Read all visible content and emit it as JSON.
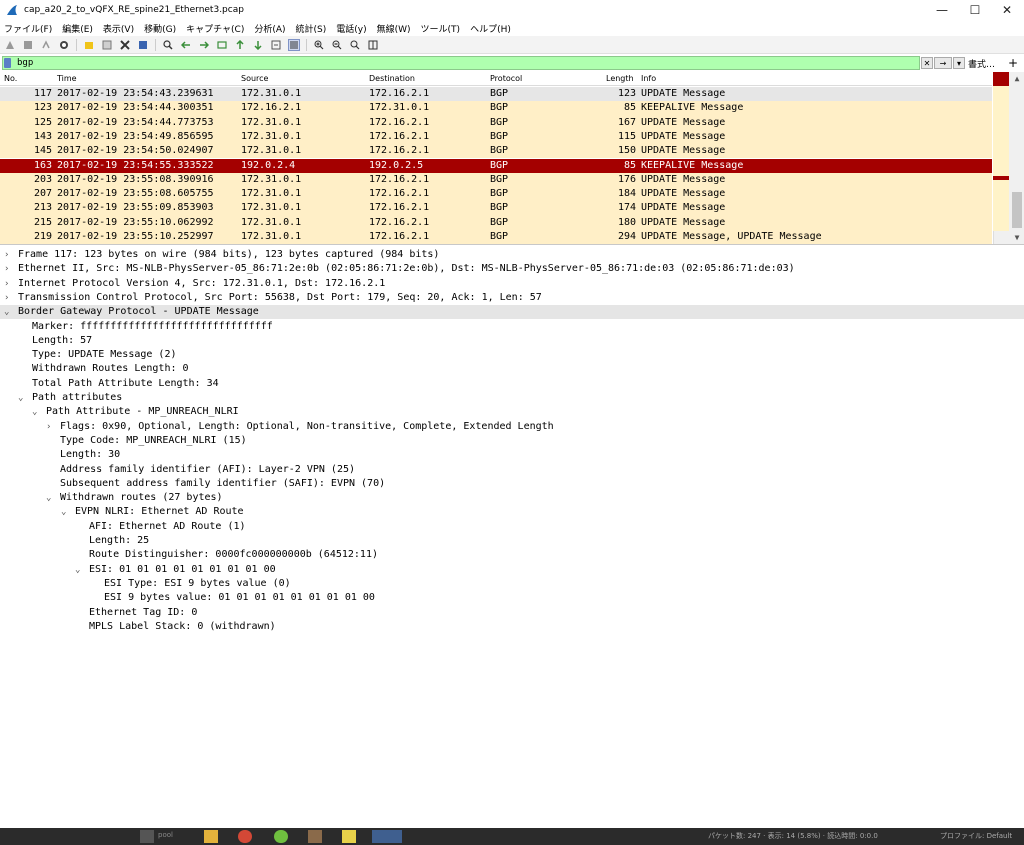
{
  "window": {
    "title": "cap_a20_2_to_vQFX_RE_spine21_Ethernet3.pcap",
    "minimize": "—",
    "maximize": "☐",
    "close": "✕"
  },
  "menu": [
    "ファイル(F)",
    "編集(E)",
    "表示(V)",
    "移動(G)",
    "キャプチャ(C)",
    "分析(A)",
    "統計(S)",
    "電話(y)",
    "無線(W)",
    "ツール(T)",
    "ヘルプ(H)"
  ],
  "filter": {
    "value": "bgp",
    "expression_label": "書式…",
    "plus": "+"
  },
  "packet_list": {
    "columns": [
      "No.",
      "Time",
      "Source",
      "Destination",
      "Protocol",
      "Length",
      "Info"
    ],
    "rows": [
      {
        "no": "117",
        "time": "2017-02-19 23:54:43.239631",
        "src": "172.31.0.1",
        "dst": "172.16.2.1",
        "proto": "BGP",
        "len": "123",
        "info": "UPDATE Message"
      },
      {
        "no": "123",
        "time": "2017-02-19 23:54:44.300351",
        "src": "172.16.2.1",
        "dst": "172.31.0.1",
        "proto": "BGP",
        "len": "85",
        "info": "KEEPALIVE Message"
      },
      {
        "no": "125",
        "time": "2017-02-19 23:54:44.773753",
        "src": "172.31.0.1",
        "dst": "172.16.2.1",
        "proto": "BGP",
        "len": "167",
        "info": "UPDATE Message"
      },
      {
        "no": "143",
        "time": "2017-02-19 23:54:49.856595",
        "src": "172.31.0.1",
        "dst": "172.16.2.1",
        "proto": "BGP",
        "len": "115",
        "info": "UPDATE Message"
      },
      {
        "no": "145",
        "time": "2017-02-19 23:54:50.024907",
        "src": "172.31.0.1",
        "dst": "172.16.2.1",
        "proto": "BGP",
        "len": "150",
        "info": "UPDATE Message"
      },
      {
        "no": "163",
        "time": "2017-02-19 23:54:55.333522",
        "src": "192.0.2.4",
        "dst": "192.0.2.5",
        "proto": "BGP",
        "len": "85",
        "info": "KEEPALIVE Message"
      },
      {
        "no": "203",
        "time": "2017-02-19 23:55:08.390916",
        "src": "172.31.0.1",
        "dst": "172.16.2.1",
        "proto": "BGP",
        "len": "176",
        "info": "UPDATE Message"
      },
      {
        "no": "207",
        "time": "2017-02-19 23:55:08.605755",
        "src": "172.31.0.1",
        "dst": "172.16.2.1",
        "proto": "BGP",
        "len": "184",
        "info": "UPDATE Message"
      },
      {
        "no": "213",
        "time": "2017-02-19 23:55:09.853903",
        "src": "172.31.0.1",
        "dst": "172.16.2.1",
        "proto": "BGP",
        "len": "174",
        "info": "UPDATE Message"
      },
      {
        "no": "215",
        "time": "2017-02-19 23:55:10.062992",
        "src": "172.31.0.1",
        "dst": "172.16.2.1",
        "proto": "BGP",
        "len": "180",
        "info": "UPDATE Message"
      },
      {
        "no": "219",
        "time": "2017-02-19 23:55:10.252997",
        "src": "172.31.0.1",
        "dst": "172.16.2.1",
        "proto": "BGP",
        "len": "294",
        "info": "UPDATE Message, UPDATE Message"
      }
    ]
  },
  "details": [
    {
      "text": "Frame 117: 123 bytes on wire (984 bits), 123 bytes captured (984 bits)",
      "level": 0,
      "arrow": "›"
    },
    {
      "text": "Ethernet II, Src: MS-NLB-PhysServer-05_86:71:2e:0b (02:05:86:71:2e:0b), Dst: MS-NLB-PhysServer-05_86:71:de:03 (02:05:86:71:de:03)",
      "level": 0,
      "arrow": "›"
    },
    {
      "text": "Internet Protocol Version 4, Src: 172.31.0.1, Dst: 172.16.2.1",
      "level": 0,
      "arrow": "›"
    },
    {
      "text": "Transmission Control Protocol, Src Port: 55638, Dst Port: 179, Seq: 20, Ack: 1, Len: 57",
      "level": 0,
      "arrow": "›"
    },
    {
      "text": "Border Gateway Protocol - UPDATE Message",
      "level": 0,
      "arrow": "⌄",
      "selected": true
    },
    {
      "text": "Marker: ffffffffffffffffffffffffffffffff",
      "level": 1,
      "arrow": ""
    },
    {
      "text": "Length: 57",
      "level": 1,
      "arrow": ""
    },
    {
      "text": "Type: UPDATE Message (2)",
      "level": 1,
      "arrow": ""
    },
    {
      "text": "Withdrawn Routes Length: 0",
      "level": 1,
      "arrow": ""
    },
    {
      "text": "Total Path Attribute Length: 34",
      "level": 1,
      "arrow": ""
    },
    {
      "text": "Path attributes",
      "level": 1,
      "arrow": "⌄"
    },
    {
      "text": "Path Attribute - MP_UNREACH_NLRI",
      "level": 2,
      "arrow": "⌄"
    },
    {
      "text": "Flags: 0x90, Optional, Length: Optional, Non-transitive, Complete, Extended Length",
      "level": 3,
      "arrow": "›"
    },
    {
      "text": "Type Code: MP_UNREACH_NLRI (15)",
      "level": 3,
      "arrow": ""
    },
    {
      "text": "Length: 30",
      "level": 3,
      "arrow": ""
    },
    {
      "text": "Address family identifier (AFI): Layer-2 VPN (25)",
      "level": 3,
      "arrow": ""
    },
    {
      "text": "Subsequent address family identifier (SAFI): EVPN (70)",
      "level": 3,
      "arrow": ""
    },
    {
      "text": "Withdrawn routes (27 bytes)",
      "level": 3,
      "arrow": "⌄"
    },
    {
      "text": "EVPN NLRI: Ethernet AD Route",
      "level": 4,
      "arrow": "⌄"
    },
    {
      "text": "AFI: Ethernet AD Route (1)",
      "level": 5,
      "arrow": ""
    },
    {
      "text": "Length: 25",
      "level": 5,
      "arrow": ""
    },
    {
      "text": "Route Distinguisher: 0000fc000000000b (64512:11)",
      "level": 5,
      "arrow": ""
    },
    {
      "text": "ESI: 01 01 01 01 01 01 01 01 00",
      "level": 5,
      "arrow": "⌄"
    },
    {
      "text": "ESI Type: ESI 9 bytes value (0)",
      "level": 6,
      "arrow": ""
    },
    {
      "text": "ESI 9 bytes value: 01 01 01 01 01 01 01 01 00",
      "level": 6,
      "arrow": ""
    },
    {
      "text": "Ethernet Tag ID: 0",
      "level": 5,
      "arrow": ""
    },
    {
      "text": "MPLS Label Stack: 0 (withdrawn)",
      "level": 5,
      "arrow": ""
    }
  ],
  "status": {
    "packets": "パケット数: 247 · 表示: 14 (5.8%) · 読込時間: 0:0.0",
    "profile": "プロファイル: Default",
    "taskbar_label": "pool"
  },
  "colors": {
    "row_bg": "#ffefc7",
    "selected_bg": "#a40000",
    "filter_bg": "#afffaf"
  }
}
